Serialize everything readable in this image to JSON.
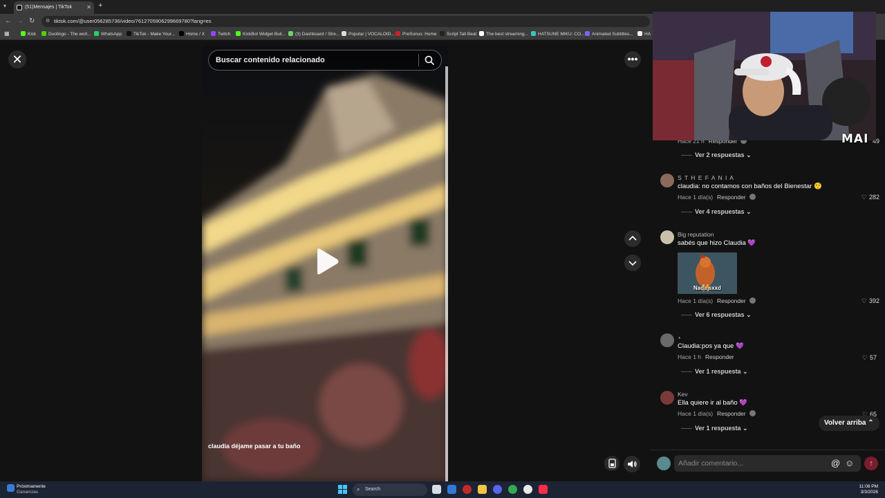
{
  "browser": {
    "tab_title": "(51)Mensajes | TikTok",
    "url": "tiktok.com/@user056285736/video/7612705906299669780?lang=es",
    "bookmarks": [
      {
        "label": "Kick",
        "color": "#53fc18"
      },
      {
        "label": "Duolingo - The worl...",
        "color": "#58cc02"
      },
      {
        "label": "WhatsApp",
        "color": "#25d366"
      },
      {
        "label": "TikTok - Make Your...",
        "color": "#111111"
      },
      {
        "label": "Home / X",
        "color": "#000000"
      },
      {
        "label": "Twitch",
        "color": "#9146ff"
      },
      {
        "label": "KickBot Widget Buil...",
        "color": "#53fc18"
      },
      {
        "label": "(3) Dashboard / Stre...",
        "color": "#6dd36d"
      },
      {
        "label": "Popular | VOCALOID...",
        "color": "#dddddd"
      },
      {
        "label": "PreSonus: Home",
        "color": "#cc2222"
      },
      {
        "label": "Script Tall Beat",
        "color": "#222222"
      },
      {
        "label": "The best streaming...",
        "color": "#ffffff"
      },
      {
        "label": "HATSUNE MIKU: CO...",
        "color": "#39c5bb"
      },
      {
        "label": "Animated Subtitles...",
        "color": "#7b61ff"
      },
      {
        "label": "HA",
        "color": "#eeeeee"
      }
    ]
  },
  "video": {
    "search_placeholder": "Buscar contenido relacionado",
    "caption": "claudia déjame pasar a tu baño"
  },
  "webcam": {
    "label": "MAI"
  },
  "comments": [
    {
      "name": "",
      "text": "",
      "meta": "Hace 21 h",
      "reply": "Responder",
      "likes": "49",
      "replies": "Ver 2 respuestas"
    },
    {
      "name": "S T H E F A N I A",
      "text": "claudia: no contamos con baños del Bienestar 🤨",
      "meta": "Hace 1 día(s)",
      "reply": "Responder",
      "likes": "282",
      "replies": "Ver 4 respuestas"
    },
    {
      "name": "Big reputation",
      "text": "sabés que hizo Claudia 💜",
      "gif_text": "Nada sxxd",
      "meta": "Hace 1 día(s)",
      "reply": "Responder",
      "likes": "392",
      "replies": "Ver 6 respuestas"
    },
    {
      "name": "⋆",
      "text": "Claudia:pos ya que 💜",
      "meta": "Hace 1 h",
      "reply": "Responder",
      "likes": "57",
      "replies": "Ver 1 respuesta"
    },
    {
      "name": "Kev",
      "text": "Ella quiere ir al baño 💜",
      "meta": "Hace 1 día(s)",
      "reply": "Responder",
      "likes": "65",
      "replies": "Ver 1 respuesta"
    }
  ],
  "back_to_top": "Volver arriba",
  "comment_input": {
    "placeholder": "Añadir comentario..."
  },
  "taskbar": {
    "weather_line1": "Próximamente",
    "weather_line2": "Ganancias",
    "search_label": "Search",
    "time": "11:08 PM",
    "date": "3/3/2026"
  }
}
